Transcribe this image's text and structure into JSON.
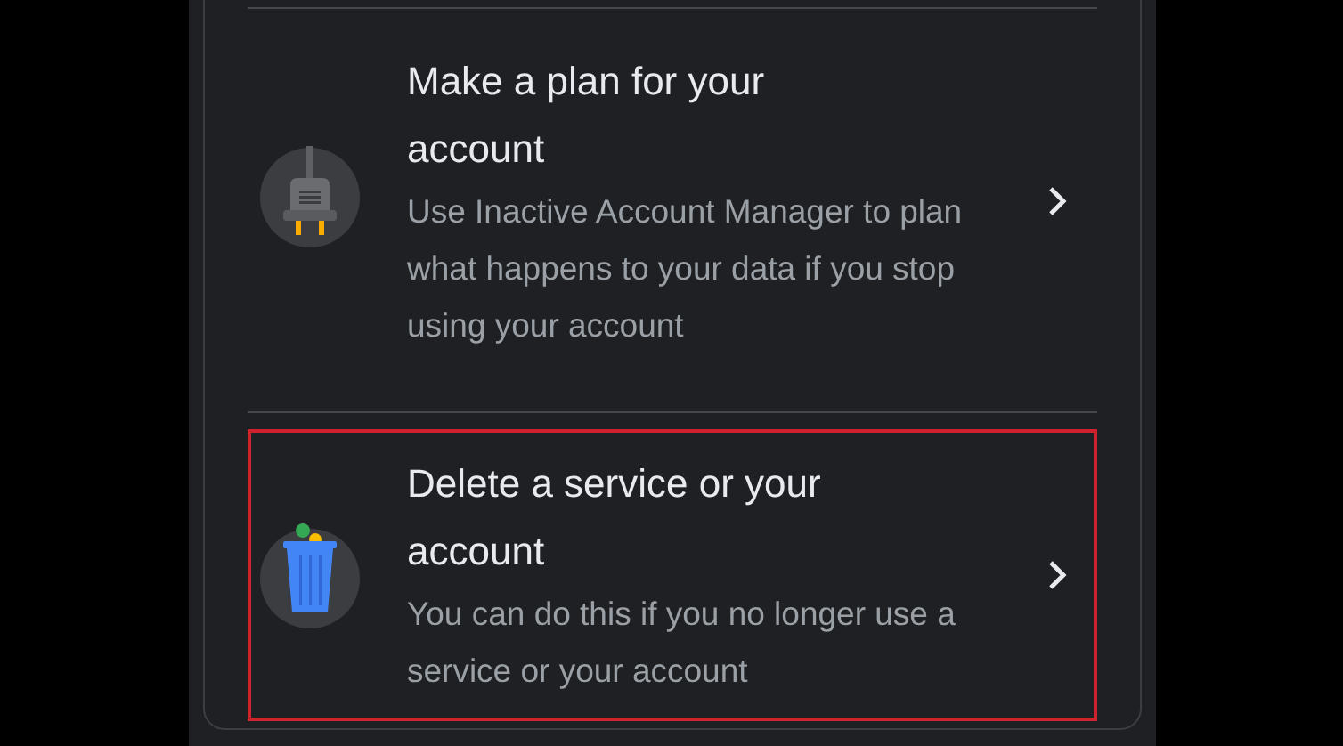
{
  "items": [
    {
      "kind": "plug",
      "title": "Make a plan for your account",
      "description": "Use Inactive Account Manager to plan what happens to your data if you stop using your account",
      "highlighted": false
    },
    {
      "kind": "trash",
      "title": "Delete a service or your account",
      "description": "You can do this if you no longer use a service or your account",
      "highlighted": true
    }
  ]
}
